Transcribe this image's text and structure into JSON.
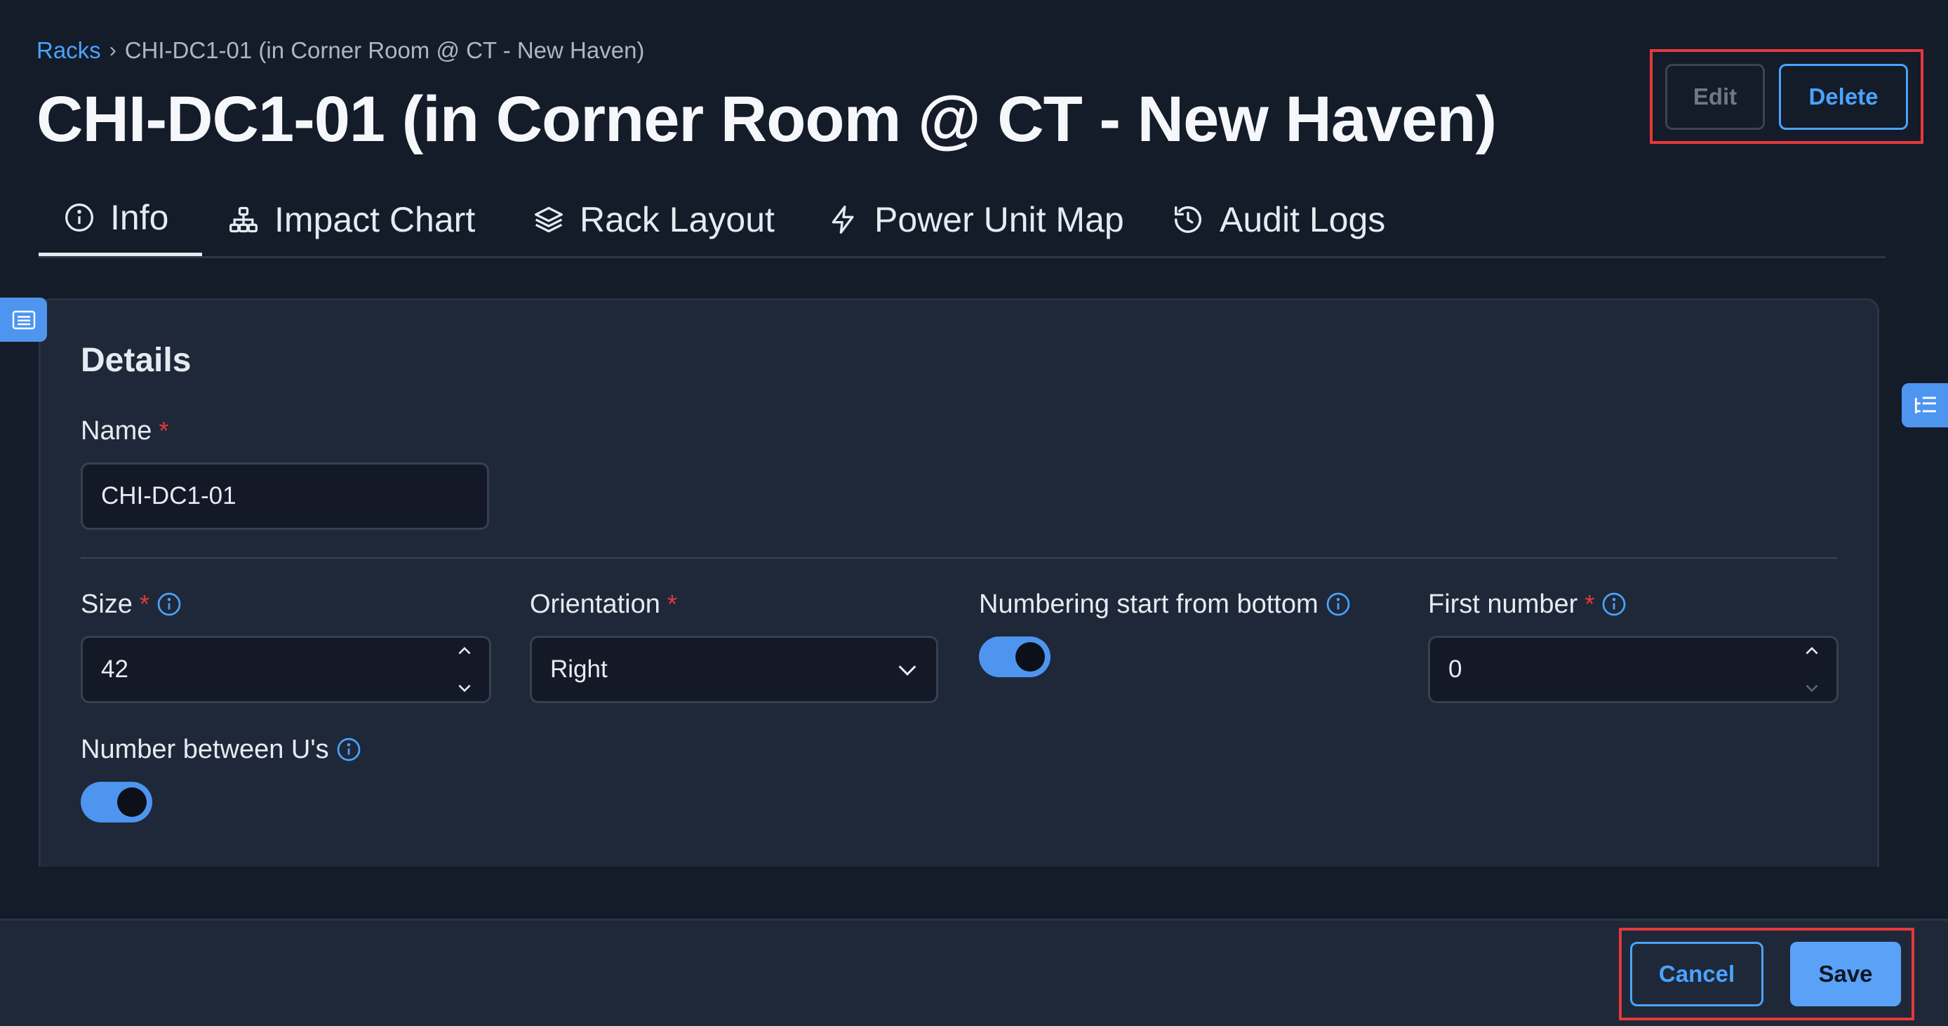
{
  "breadcrumb": {
    "link": "Racks",
    "separator": "›",
    "current": "CHI-DC1-01 (in Corner Room @ CT - New Haven)"
  },
  "page_title": "CHI-DC1-01 (in Corner Room @ CT - New Haven)",
  "header_actions": {
    "edit_label": "Edit",
    "delete_label": "Delete"
  },
  "tabs": [
    {
      "label": "Info",
      "icon": "info-circle-icon",
      "active": true
    },
    {
      "label": "Impact Chart",
      "icon": "hierarchy-icon",
      "active": false
    },
    {
      "label": "Rack Layout",
      "icon": "layers-icon",
      "active": false
    },
    {
      "label": "Power Unit Map",
      "icon": "lightning-icon",
      "active": false
    },
    {
      "label": "Audit Logs",
      "icon": "history-icon",
      "active": false
    }
  ],
  "details": {
    "title": "Details",
    "name": {
      "label": "Name",
      "required_mark": "*",
      "value": "CHI-DC1-01"
    },
    "size": {
      "label": "Size",
      "required_mark": "*",
      "value": "42"
    },
    "orientation": {
      "label": "Orientation",
      "required_mark": "*",
      "value": "Right"
    },
    "numbering_start_from_bottom": {
      "label": "Numbering start from bottom",
      "enabled": true
    },
    "first_number": {
      "label": "First number",
      "required_mark": "*",
      "value": "0"
    },
    "number_between_us": {
      "label": "Number between U's",
      "enabled": true
    }
  },
  "footer": {
    "cancel_label": "Cancel",
    "save_label": "Save"
  },
  "colors": {
    "accent": "#4aa3ff",
    "required": "#e5383b",
    "highlight": "#e5383b",
    "background": "#141b29",
    "panel": "#1f2838"
  }
}
